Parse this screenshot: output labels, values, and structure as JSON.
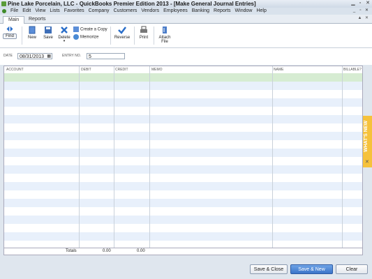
{
  "window": {
    "title": "Pine Lake Porcelain, LLC  - QuickBooks Premier Edition 2013 - [Make General Journal Entries]"
  },
  "menu": [
    "File",
    "Edit",
    "View",
    "Lists",
    "Favorites",
    "Company",
    "Customers",
    "Vendors",
    "Employees",
    "Banking",
    "Reports",
    "Window",
    "Help"
  ],
  "tabs": [
    "Main",
    "Reports"
  ],
  "toolbar": {
    "find": "Find",
    "new": "New",
    "save": "Save",
    "delete": "Delete",
    "create_copy": "Create a Copy",
    "memorize": "Memorize",
    "reverse": "Reverse",
    "print": "Print",
    "attach_line1": "Attach",
    "attach_line2": "File"
  },
  "form": {
    "date_label": "DATE",
    "date_value": "08/31/2013",
    "entry_label": "ENTRY NO.",
    "entry_value": "5"
  },
  "grid": {
    "columns": [
      "ACCOUNT",
      "DEBIT",
      "CREDIT",
      "MEMO",
      "NAME",
      "BILLABLE?"
    ],
    "selected_row_color": "#d6ecd2",
    "alt_row_color": "#e8f0fb"
  },
  "totals": {
    "label": "Totals",
    "debit": "0.00",
    "credit": "0.00"
  },
  "buttons": {
    "save_close": "Save & Close",
    "save_new": "Save & New",
    "clear": "Clear"
  },
  "whats_new": {
    "label": "WHAT'S NEW",
    "close": "✕"
  }
}
